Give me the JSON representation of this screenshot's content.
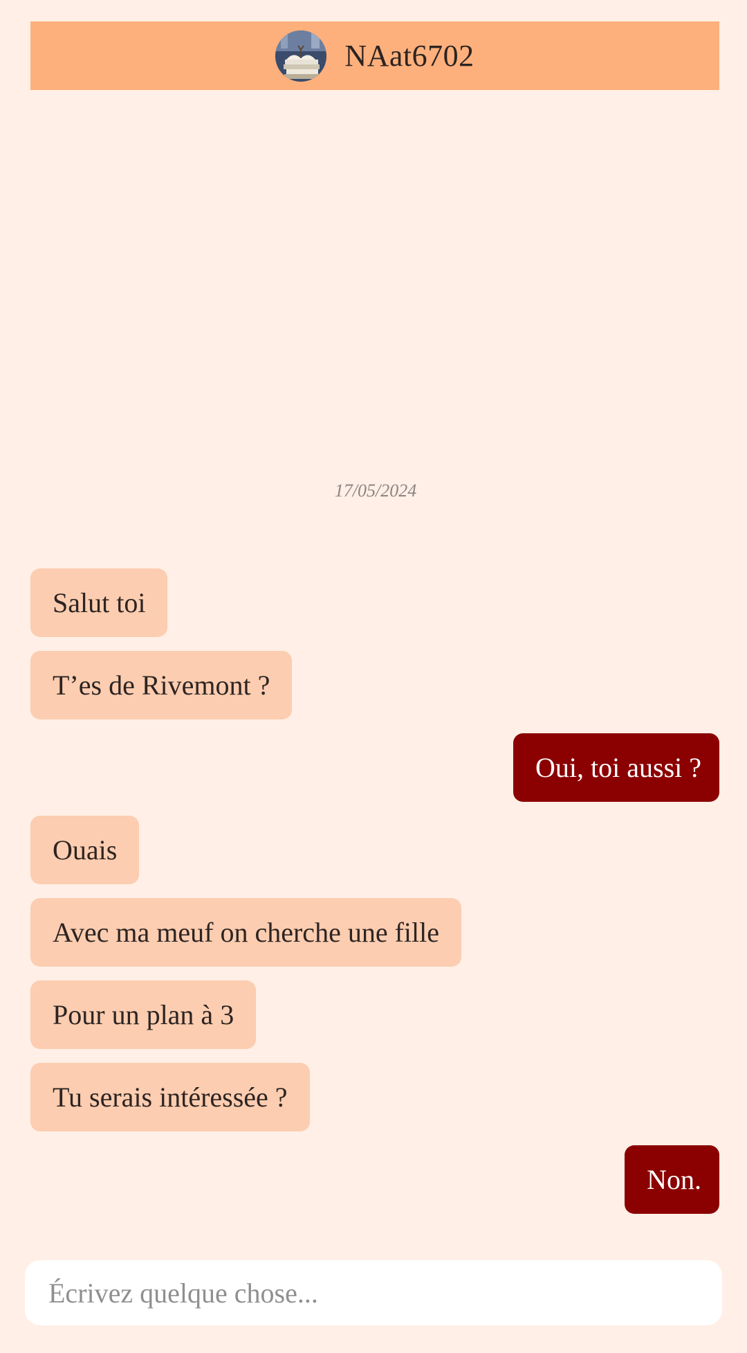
{
  "header": {
    "username": "NAat6702",
    "avatar_icon": "books-avatar-icon"
  },
  "conversation": {
    "date": "17/05/2024",
    "messages": [
      {
        "from": "them",
        "text": "Salut toi"
      },
      {
        "from": "them",
        "text": "T’es de Rivemont ?"
      },
      {
        "from": "me",
        "text": "Oui, toi aussi ?"
      },
      {
        "from": "them",
        "text": "Ouais"
      },
      {
        "from": "them",
        "text": "Avec ma meuf on cherche une fille"
      },
      {
        "from": "them",
        "text": "Pour un plan à 3"
      },
      {
        "from": "them",
        "text": "Tu serais intéressée ?"
      },
      {
        "from": "me",
        "text": "Non."
      }
    ]
  },
  "composer": {
    "placeholder": "Écrivez quelque chose..."
  },
  "colors": {
    "page_background": "#ffefe6",
    "header_background": "#feb07c",
    "incoming_bubble": "#fccdb0",
    "outgoing_bubble": "#8b0000"
  }
}
